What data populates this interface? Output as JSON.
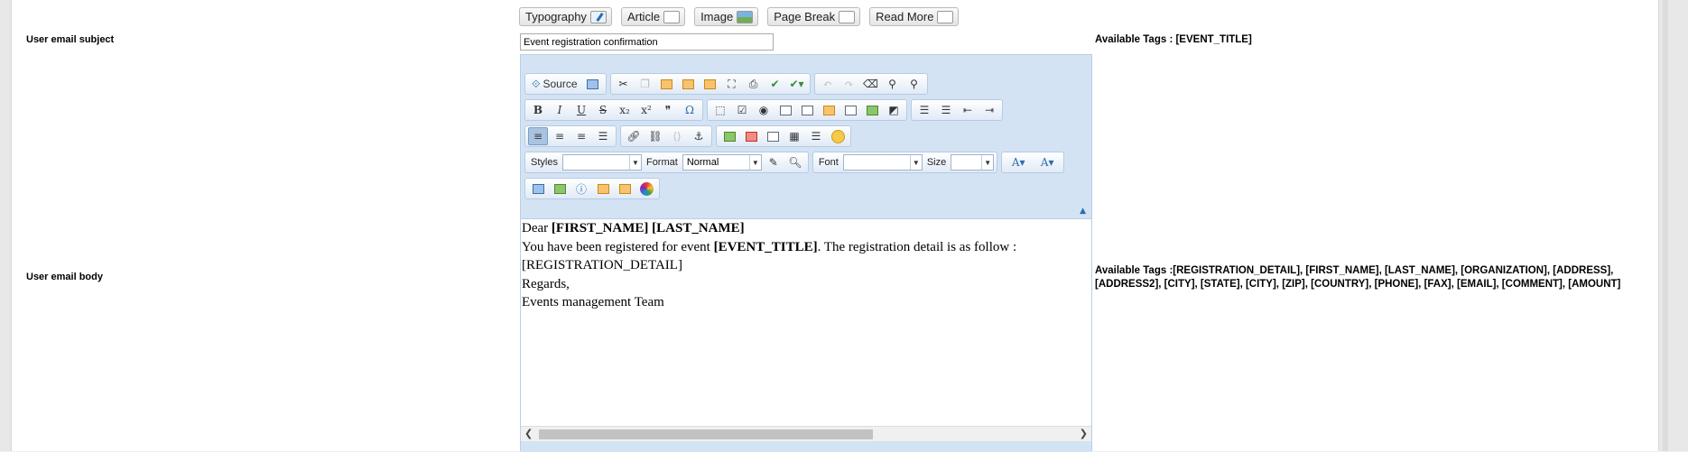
{
  "top_buttons": [
    {
      "label": "Typography",
      "icon": "typography-icon"
    },
    {
      "label": "Article",
      "icon": "article-icon"
    },
    {
      "label": "Image",
      "icon": "image-icon"
    },
    {
      "label": "Page Break",
      "icon": "page-break-icon"
    },
    {
      "label": "Read More",
      "icon": "read-more-icon"
    }
  ],
  "subject": {
    "label": "User email subject",
    "value": "Event registration confirmation",
    "tags": "Available Tags : [EVENT_TITLE]"
  },
  "body": {
    "label": "User email body",
    "tags_line1": "Available Tags :[REGISTRATION_DETAIL], [FIRST_NAME], [LAST_NAME], [ORGANIZATION], [ADDRESS],",
    "tags_line2": "[ADDRESS2], [CITY], [STATE], [CITY], [ZIP], [COUNTRY], [PHONE], [FAX], [EMAIL], [COMMENT], [AMOUNT]"
  },
  "toolbar": {
    "source_label": "Source",
    "styles_label": "Styles",
    "styles_value": "",
    "format_label": "Format",
    "format_value": "Normal",
    "font_label": "Font",
    "font_value": "",
    "size_label": "Size",
    "size_value": "",
    "bold": "B",
    "italic": "I",
    "underline": "U",
    "strike": "S",
    "subscript": "x₂",
    "superscript": "x²",
    "quote": "❞",
    "omega": "Ω"
  },
  "content": {
    "line1_prefix": "Dear ",
    "line1_bold": "[FIRST_NAME] [LAST_NAME]",
    "line2_prefix": "You have been registered for event ",
    "line2_bold": "[EVENT_TITLE]",
    "line2_suffix": ". The registration detail is as follow :",
    "line3": "[REGISTRATION_DETAIL]",
    "line4": "Regards,",
    "line5": "Events management Team"
  },
  "colors": {
    "editor_bg": "#d3e3f4",
    "panel_bg": "#ffffff"
  }
}
